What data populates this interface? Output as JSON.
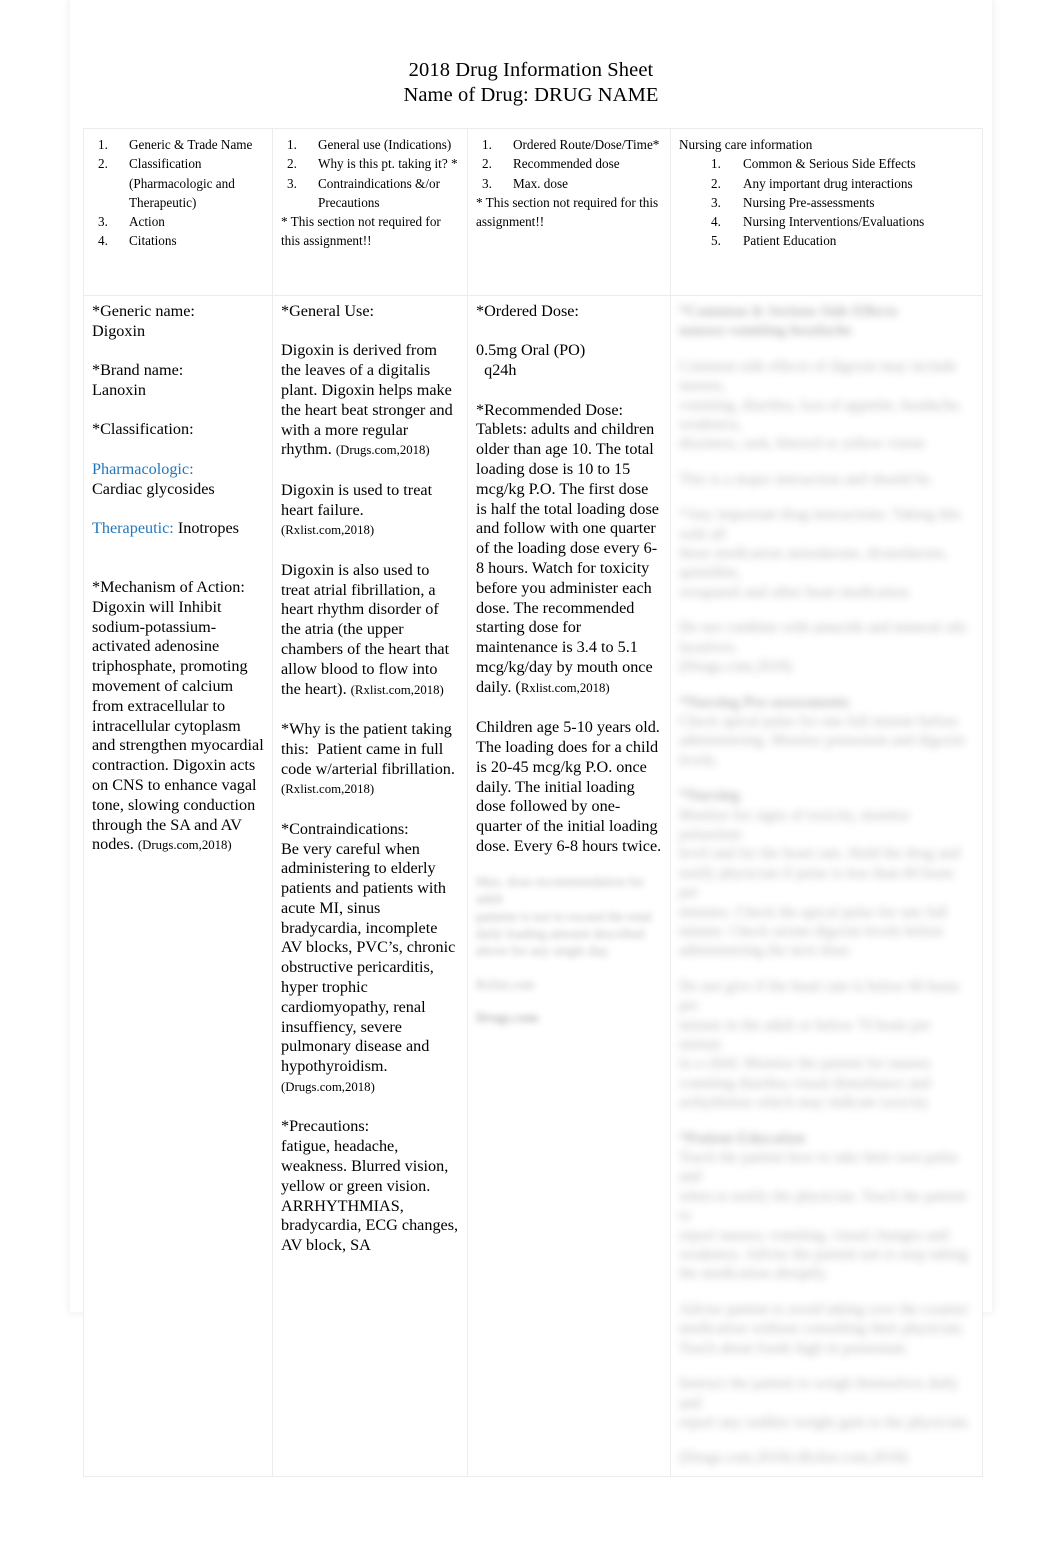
{
  "document": {
    "title_line1": "2018 Drug Information Sheet",
    "title_line2": "Name of Drug: DRUG NAME"
  },
  "header_row": {
    "column1": {
      "items": [
        {
          "num": "1.",
          "label": "Generic & Trade Name"
        },
        {
          "num": "2.",
          "label": "Classification (Pharmacologic and Therapeutic)"
        },
        {
          "num": "3.",
          "label": "Action"
        },
        {
          "num": "4.",
          "label": "Citations"
        }
      ]
    },
    "column2": {
      "items": [
        {
          "num": "1.",
          "label": "General use (Indications)"
        },
        {
          "num": "2.",
          "label": "Why is this pt. taking it?  *"
        },
        {
          "num": "3.",
          "label": "Contraindications &/or Precautions"
        }
      ],
      "note": "* This section not required for this assignment!!"
    },
    "column3": {
      "items": [
        {
          "num": "1.",
          "label": "Ordered Route/Dose/Time*"
        },
        {
          "num": "2.",
          "label": "Recommended dose"
        },
        {
          "num": "3.",
          "label": "Max. dose"
        }
      ],
      "note": "* This section not required for this assignment!!"
    },
    "column4": {
      "heading": "Nursing care information",
      "items": [
        {
          "num": "1.",
          "label": "Common & Serious Side Effects"
        },
        {
          "num": "2.",
          "label": "Any important drug interactions"
        },
        {
          "num": "3.",
          "label": "Nursing Pre-assessments"
        },
        {
          "num": "4.",
          "label": "Nursing Interventions/Evaluations"
        },
        {
          "num": "5.",
          "label": "Patient Education"
        }
      ]
    }
  },
  "body_row": {
    "column1": {
      "generic_label": "*Generic name:",
      "generic_value": "Digoxin",
      "brand_label": "*Brand name:",
      "brand_value": "Lanoxin",
      "classification_label": "*Classification:",
      "pharmacologic_label": "Pharmacologic:",
      "pharmacologic_value": "Cardiac glycosides",
      "therapeutic_label": "Therapeutic:",
      "therapeutic_value": "Inotropes",
      "moa_label": "*Mechanism of Action:",
      "moa_text": "Digoxin will Inhibit sodium-potassium-activated adenosine triphosphate, promoting movement of calcium from extracellular to intracellular cytoplasm and strengthen myocardial contraction. Digoxin acts on CNS to enhance vagal tone, slowing conduction through the SA and AV nodes.",
      "moa_citation": "(Drugs.com,2018)"
    },
    "column2": {
      "general_use_label": "*General Use:",
      "para1": "Digoxin is derived from the leaves of a digitalis plant. Digoxin helps make the heart beat stronger and with a more regular rhythm.",
      "para1_citation": "(Drugs.com,2018)",
      "para2": "Digoxin is used to treat heart failure.",
      "para2_citation": "(Rxlist.com,2018)",
      "para3": "Digoxin is also used to treat atrial fibrillation, a heart rhythm disorder of the atria (the upper chambers of the heart that allow blood to flow into the heart).",
      "para3_citation": "(Rxlist.com,2018)",
      "why_label": "*Why is the patient taking this:",
      "why_text": "Patient came in full code w/arterial fibrillation.",
      "why_citation": "(Rxlist.com,2018)",
      "contraindications_label": "*Contraindications:",
      "contraindications_text": "Be very careful when administering to elderly patients and patients with acute MI, sinus bradycardia, incomplete AV blocks, PVC’s, chronic obstructive pericarditis, hyper trophic cardiomyopathy, renal insuffiency, severe pulmonary disease and hypothyroidism.",
      "contraindications_citation": "(Drugs.com,2018)",
      "precautions_label": "*Precautions:",
      "precautions_text": "fatigue, headache, weakness. Blurred vision, yellow or green vision. ARRHYTHMIAS, bradycardia, ECG changes, AV block, SA"
    },
    "column3": {
      "ordered_dose_label": "*Ordered Dose:",
      "ordered_dose_value": "0.5mg Oral (PO)",
      "ordered_dose_freq": "q24h",
      "recommended_dose_label": "*Recommended Dose:",
      "recommended_dose_text": "Tablets: adults and children older than age 10. The total loading dose is 10 to 15 mcg/kg P.O.  The first dose is half the total loading dose and follow with one quarter of the loading dose every 6-8 hours. Watch for toxicity before you administer each dose. The recommended starting dose for maintenance is 3.4 to 5.1 mcg/kg/day by mouth once daily. (",
      "recommended_dose_citation": "Rxlist.com,2018)",
      "children_text": "Children age 5-10 years old. The loading does for a child is 20-45 mcg/kg P.O. once daily. The initial loading dose followed by one-quarter of the initial loading dose. Every 6-8 hours twice.",
      "obscured_note": "[blurred / illegible text]"
    },
    "column4": {
      "obscured_note": "[blurred / illegible text]"
    }
  }
}
